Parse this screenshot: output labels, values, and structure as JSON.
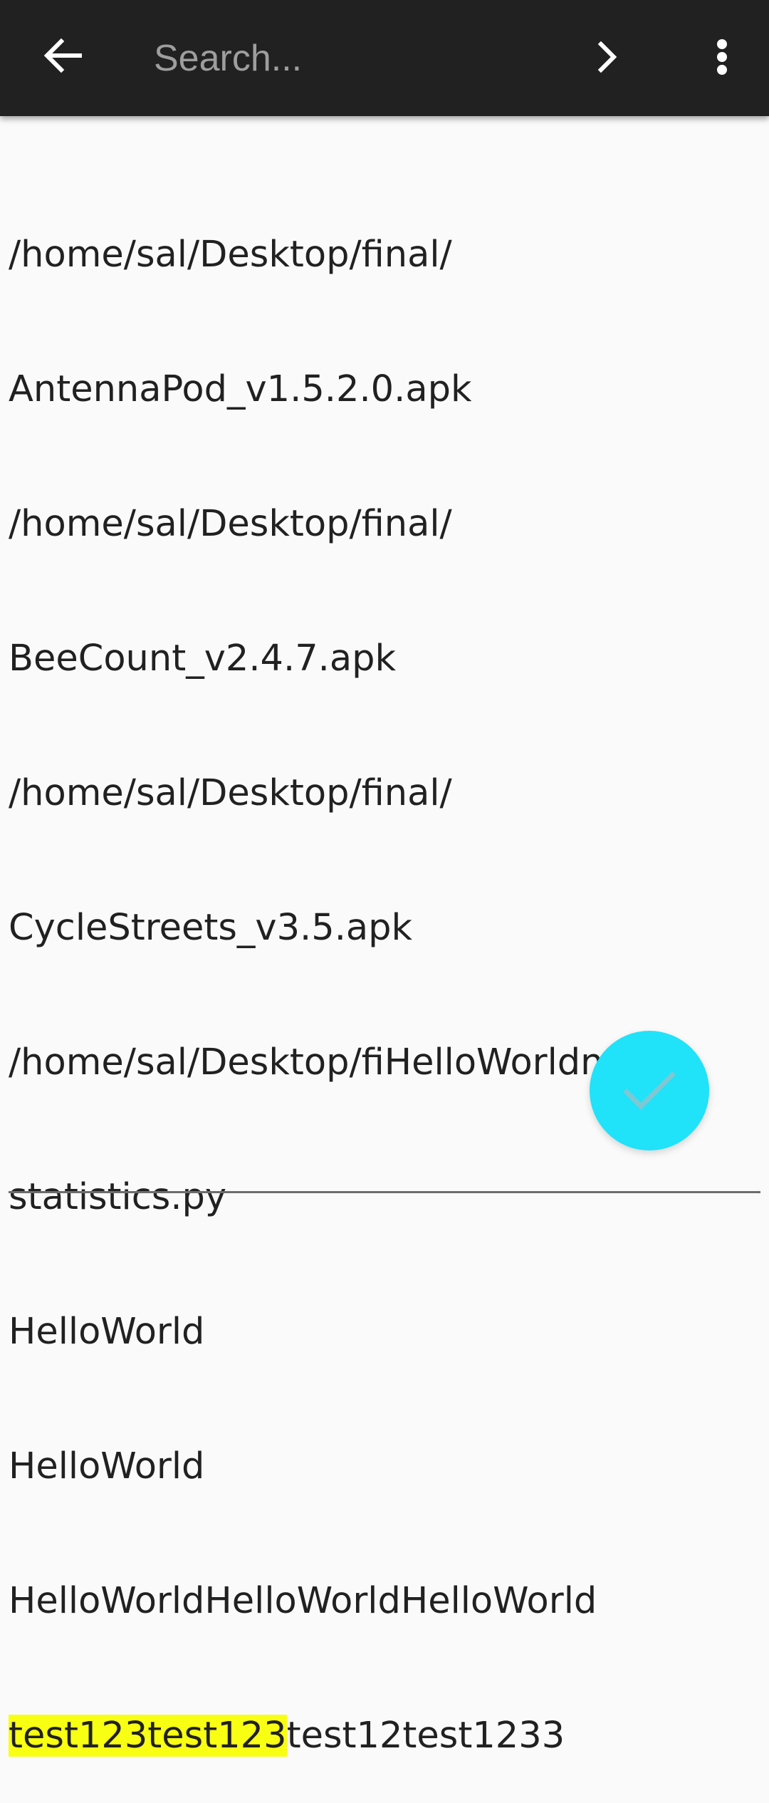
{
  "toolbar": {
    "back_icon": "arrow-left-icon",
    "search_placeholder": "Search...",
    "search_value": "",
    "next_icon": "chevron-right-icon",
    "menu_icon": "more-vertical-icon",
    "background_color": "#212121",
    "placeholder_color": "#9e9e9e"
  },
  "editor": {
    "lines": [
      "/home/sal/Desktop/final/",
      "AntennaPod_v1.5.2.0.apk",
      "/home/sal/Desktop/final/",
      "BeeCount_v2.4.7.apk",
      "/home/sal/Desktop/final/",
      "CycleStreets_v3.5.apk",
      "/home/sal/Desktop/fiHelloWorldnal/",
      "statistics.py",
      "HelloWorld",
      "HelloWorld",
      "HelloWorldHelloWorldHelloWorld"
    ],
    "last_line": {
      "highlighted": "test123test123",
      "rest": "test12test1233"
    },
    "highlight_color": "#f8ff13",
    "text_color": "#212121"
  },
  "fab": {
    "icon": "check-icon",
    "color": "#20e2f9"
  }
}
